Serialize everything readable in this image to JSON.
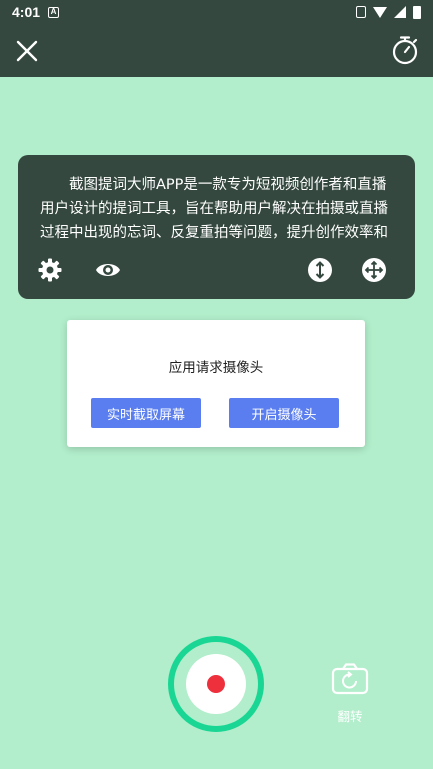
{
  "status_bar": {
    "time": "4:01",
    "notification_glyph": "A"
  },
  "toolbar": {
    "close_icon": "close-icon",
    "timer_icon": "stopwatch-icon"
  },
  "prompter": {
    "text": "截图提词大师APP是一款专为短视频创作者和直播用户设计的提词工具，旨在帮助用户解决在拍摄或直播过程中出现的忘词、反复重拍等问题，提升创作效率和作品质量。APP支持多种提词模式",
    "tools": [
      "gear-icon",
      "eye-icon",
      "vertical-resize-icon",
      "move-icon"
    ]
  },
  "dialog": {
    "title": "应用请求摄像头",
    "screen_button": "实时截取屏幕",
    "camera_button": "开启摄像头"
  },
  "bottom": {
    "flip_label": "翻转"
  },
  "colors": {
    "background": "#b2eecb",
    "bar": "#34483f",
    "accent": "#5a7ef0",
    "record_ring": "#1ad694",
    "record_dot": "#ee2f3c"
  }
}
